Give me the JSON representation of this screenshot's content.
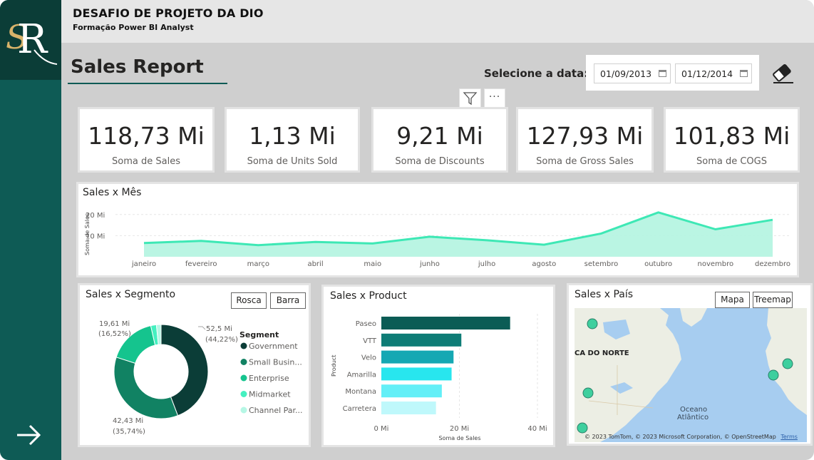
{
  "header": {
    "title": "DESAFIO DE PROJETO DA DIO",
    "subtitle": "Formação Power BI Analyst"
  },
  "page_title": "Sales Report",
  "date_filter": {
    "label": "Selecione a data:",
    "start": "01/09/2013",
    "end": "01/12/2014"
  },
  "icons": {
    "logo": "sr-monogram-logo",
    "nav": "arrow-right-icon",
    "clear": "eraser-icon",
    "filter": "filter-icon",
    "more": "more-options-icon",
    "calendar": "calendar-icon"
  },
  "kpis": [
    {
      "value": "118,73 Mi",
      "label": "Soma de  Sales"
    },
    {
      "value": "1,13 Mi",
      "label": "Soma de Units Sold"
    },
    {
      "value": "9,21 Mi",
      "label": "Soma de Discounts"
    },
    {
      "value": "127,93 Mi",
      "label": "Soma de Gross Sales"
    },
    {
      "value": "101,83 Mi",
      "label": "Soma de COGS"
    }
  ],
  "colors": {
    "sidebar": "#0e5b55",
    "logo_bg": "#0b3d37",
    "accent": "#3ee8b5"
  },
  "chart_data": [
    {
      "type": "area",
      "title": "Sales x Mês",
      "ylabel": "Soma de Sales",
      "xlabel": "",
      "categories": [
        "janeiro",
        "fevereiro",
        "março",
        "abril",
        "maio",
        "junho",
        "julho",
        "agosto",
        "setembro",
        "outubro",
        "novembro",
        "dezembro"
      ],
      "series": [
        {
          "values": [
            6.5,
            7.5,
            5.5,
            7.0,
            6.3,
            9.5,
            7.8,
            5.7,
            11.0,
            21.0,
            13.0,
            17.5
          ]
        }
      ],
      "yticks": [
        "10 Mi",
        "20 Mi"
      ],
      "ylim": [
        0,
        25
      ],
      "grid": true,
      "color": "#3ee8b5"
    },
    {
      "type": "pie",
      "title": "Sales x Segmento",
      "legend_title": "Segment",
      "buttons": [
        "Rosca",
        "Barra"
      ],
      "categories": [
        "Government",
        "Small Busin...",
        "Enterprise",
        "Midmarket",
        "Channel Par..."
      ],
      "values": [
        52.5,
        42.43,
        19.61,
        2.3,
        1.9
      ],
      "colors": [
        "#0b3d37",
        "#118263",
        "#15c48e",
        "#45f0c0",
        "#b6f7e5"
      ],
      "data_labels": [
        {
          "value": "52,5 Mi",
          "pct": "(44,22%)"
        },
        {
          "value": "42,43 Mi",
          "pct": "(35,74%)"
        },
        {
          "value": "19,61 Mi",
          "pct": "(16,52%)"
        }
      ],
      "legend_position": "right"
    },
    {
      "type": "bar",
      "orientation": "horizontal",
      "title": "Sales x Product",
      "ylabel": "Product",
      "xlabel": "Soma de Sales",
      "categories": [
        "Paseo",
        "VTT",
        "Velo",
        "Amarilla",
        "Montana",
        "Carretera"
      ],
      "values": [
        33,
        20.5,
        18.5,
        18,
        15.5,
        14
      ],
      "colors": [
        "#0b5c55",
        "#0e7c76",
        "#15a8b3",
        "#28e6ee",
        "#63eff7",
        "#bff8fb"
      ],
      "xticks": [
        "0 Mi",
        "20 Mi",
        "40 Mi"
      ],
      "xlim": [
        0,
        40
      ]
    },
    {
      "type": "map",
      "title": "Sales x País",
      "buttons": [
        "Mapa",
        "Treemap"
      ],
      "labels": [
        "CA DO NORTE",
        "Oceano",
        "Atlântico"
      ],
      "attribution": "© 2023 TomTom, © 2023 Microsoft Corporation, © OpenStreetMap",
      "attribution_link": "Terms",
      "marker_color": "#3ecf9e"
    }
  ]
}
